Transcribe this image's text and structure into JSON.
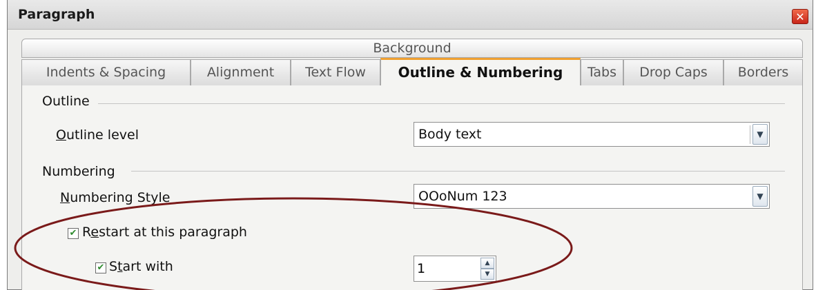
{
  "window": {
    "title": "Paragraph",
    "close_label": "✕"
  },
  "tabs": {
    "back_row": [
      "Background"
    ],
    "front_row": [
      "Indents & Spacing",
      "Alignment",
      "Text Flow",
      "Outline & Numbering",
      "Tabs",
      "Drop Caps",
      "Borders"
    ],
    "active": "Outline & Numbering"
  },
  "outline": {
    "section": "Outline",
    "level_label_first": "O",
    "level_label_rest": "utline level",
    "level_value": "Body text"
  },
  "numbering": {
    "section": "Numbering",
    "style_label_first": "N",
    "style_label_rest": "umbering Style",
    "style_value": "OOoNum 123",
    "restart_label_first": "R",
    "restart_label_mid": "e",
    "restart_label_rest": "start at this paragraph",
    "restart_checked": true,
    "start_label_first": "S",
    "start_label_mid": "t",
    "start_label_rest": "art with",
    "start_checked": true,
    "start_value": "1"
  },
  "colors": {
    "highlight_ellipse": "#7a1a1a",
    "active_tab_accent": "#f0a030"
  }
}
